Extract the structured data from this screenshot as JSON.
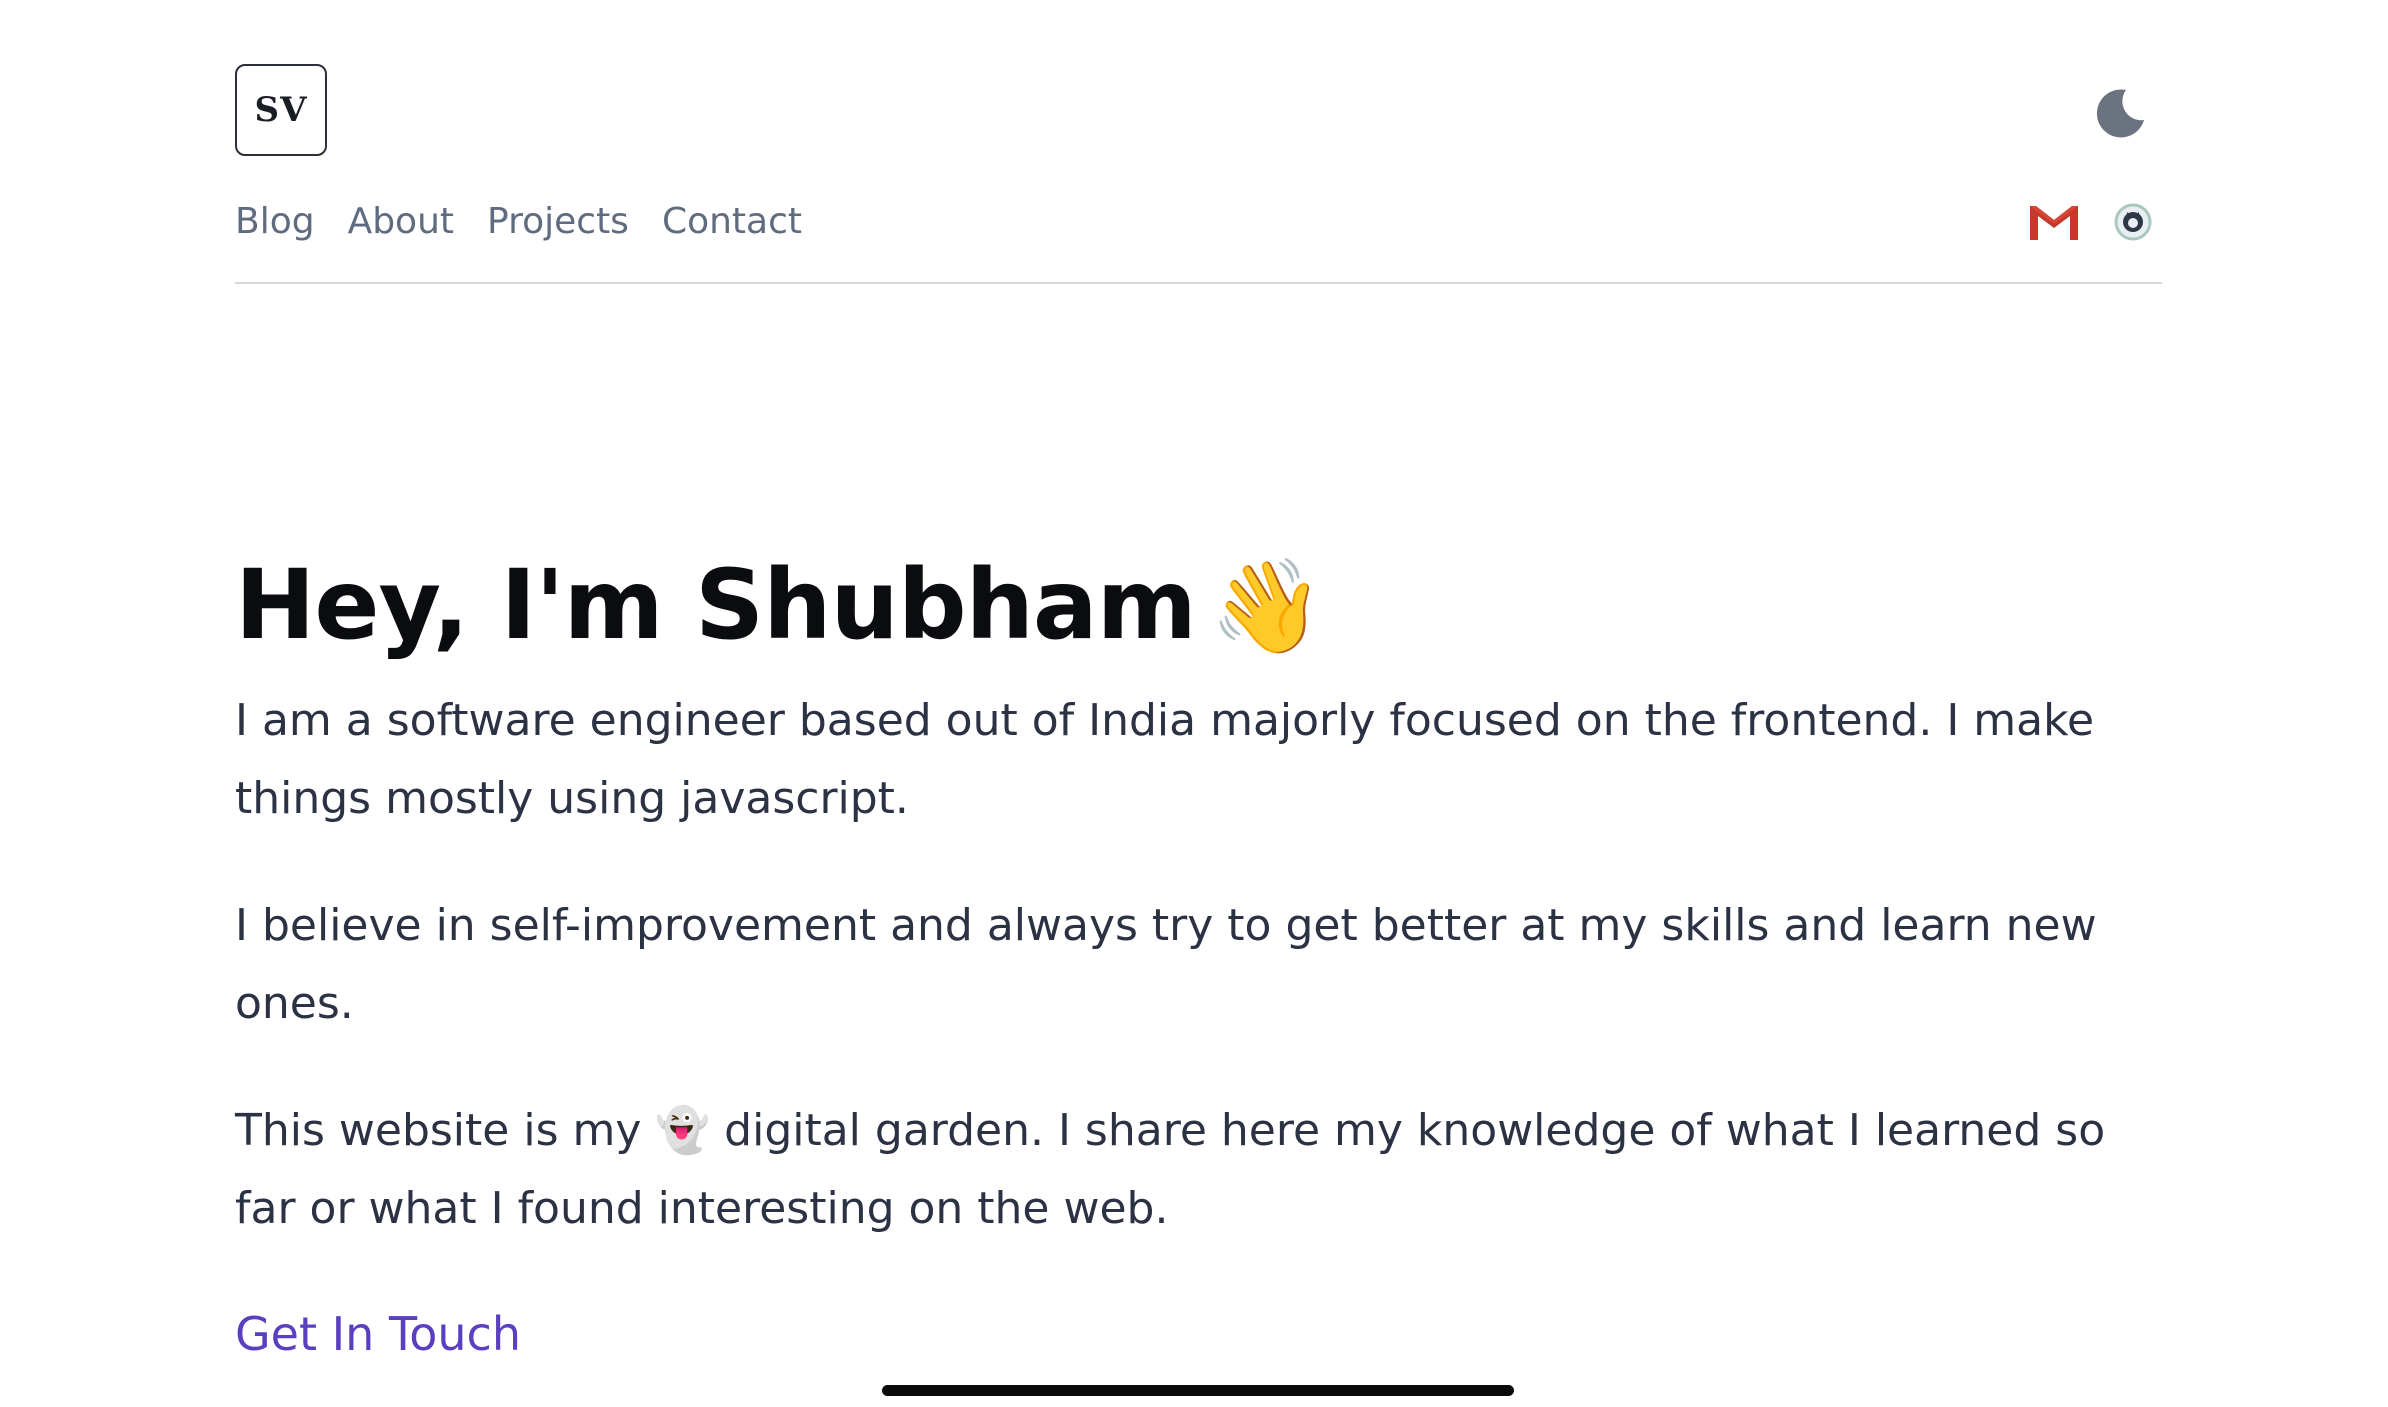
{
  "header": {
    "logo_text": "SV",
    "nav": [
      {
        "label": "Blog"
      },
      {
        "label": "About"
      },
      {
        "label": "Projects"
      },
      {
        "label": "Contact"
      }
    ],
    "theme_icon": "moon-icon",
    "social_icons": [
      "gmail-icon",
      "github-icon"
    ]
  },
  "main": {
    "title": "Hey, I'm Shubham",
    "title_emoji": "👋",
    "paragraph_1": "I am a software engineer based out of India majorly focused on the frontend. I make things mostly using javascript.",
    "paragraph_2": "I believe in self-improvement and always try to get better at my skills and learn new ones.",
    "paragraph_3_before": "This website is my ",
    "paragraph_3_emoji": "👻",
    "paragraph_3_after": " digital garden. I share here my knowledge of what I learned so far or what I found interesting on the web.",
    "cta_label": "Get In Touch"
  },
  "colors": {
    "accent": "#5a3fc0",
    "nav_text": "#5f6b7f",
    "body_text": "#2b3243",
    "heading": "#0b0c0f",
    "gmail_red": "#d44638",
    "moon": "#6b7280"
  }
}
